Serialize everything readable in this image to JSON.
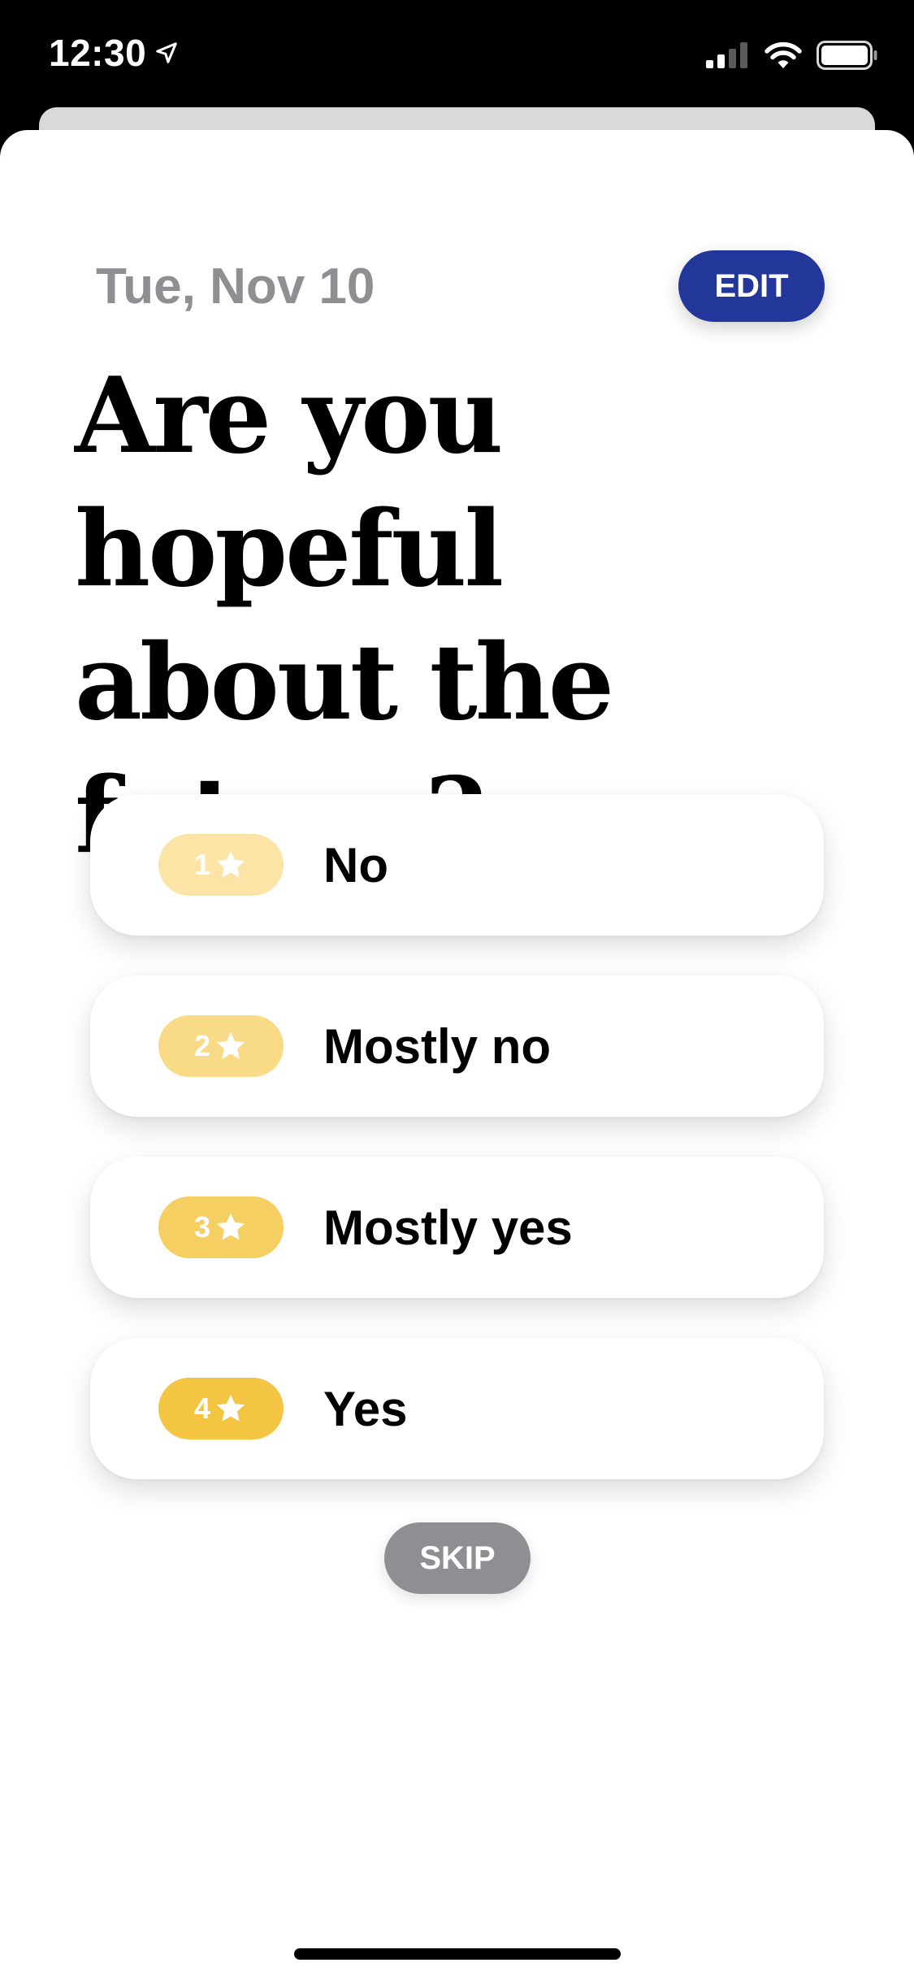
{
  "status_bar": {
    "time": "12:30",
    "location_icon": "location-arrow-icon",
    "signal_icon": "cellular-signal-icon",
    "wifi_icon": "wifi-icon",
    "battery_icon": "battery-icon"
  },
  "header": {
    "date": "Tue, Nov 10",
    "edit_label": "EDIT"
  },
  "question": {
    "text": "Are you hopeful about the future?"
  },
  "options": [
    {
      "number": "1",
      "label": "No",
      "icon": "star-icon",
      "badge_color": "#fbe4a6"
    },
    {
      "number": "2",
      "label": "Mostly no",
      "icon": "star-icon",
      "badge_color": "#f9da86"
    },
    {
      "number": "3",
      "label": "Mostly yes",
      "icon": "star-icon",
      "badge_color": "#f6cf62"
    },
    {
      "number": "4",
      "label": "Yes",
      "icon": "star-icon",
      "badge_color": "#f4c443"
    }
  ],
  "skip_label": "SKIP",
  "colors": {
    "accent": "#233699",
    "secondary_text": "#8e8e93",
    "skip_button": "#8e8e93"
  }
}
